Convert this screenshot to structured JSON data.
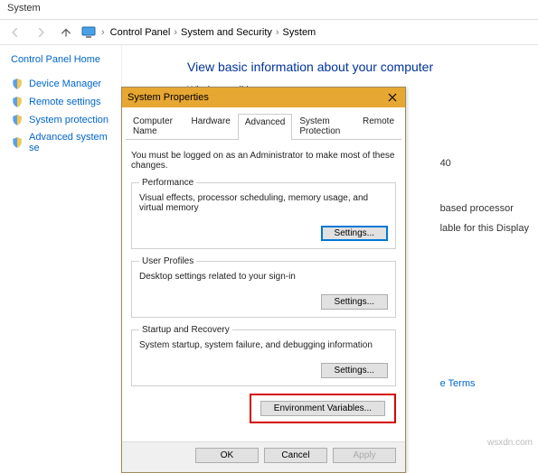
{
  "window": {
    "title": "System"
  },
  "breadcrumb": {
    "items": [
      "Control Panel",
      "System and Security",
      "System"
    ]
  },
  "sidebar": {
    "home": "Control Panel Home",
    "items": [
      {
        "label": "Device Manager"
      },
      {
        "label": "Remote settings"
      },
      {
        "label": "System protection"
      },
      {
        "label": "Advanced system se"
      }
    ]
  },
  "content": {
    "heading": "View basic information about your computer",
    "section_label": "Windows edition",
    "peek1": "40",
    "peek2": "based processor",
    "peek3": "lable for this Display",
    "link_terms": "e Terms"
  },
  "dialog": {
    "title": "System Properties",
    "tabs": [
      "Computer Name",
      "Hardware",
      "Advanced",
      "System Protection",
      "Remote"
    ],
    "active_tab": 2,
    "hint": "You must be logged on as an Administrator to make most of these changes.",
    "groups": {
      "perf": {
        "legend": "Performance",
        "desc": "Visual effects, processor scheduling, memory usage, and virtual memory",
        "button": "Settings..."
      },
      "prof": {
        "legend": "User Profiles",
        "desc": "Desktop settings related to your sign-in",
        "button": "Settings..."
      },
      "startup": {
        "legend": "Startup and Recovery",
        "desc": "System startup, system failure, and debugging information",
        "button": "Settings..."
      }
    },
    "env_button": "Environment Variables...",
    "actions": {
      "ok": "OK",
      "cancel": "Cancel",
      "apply": "Apply"
    }
  },
  "watermark": "wsxdn.com"
}
